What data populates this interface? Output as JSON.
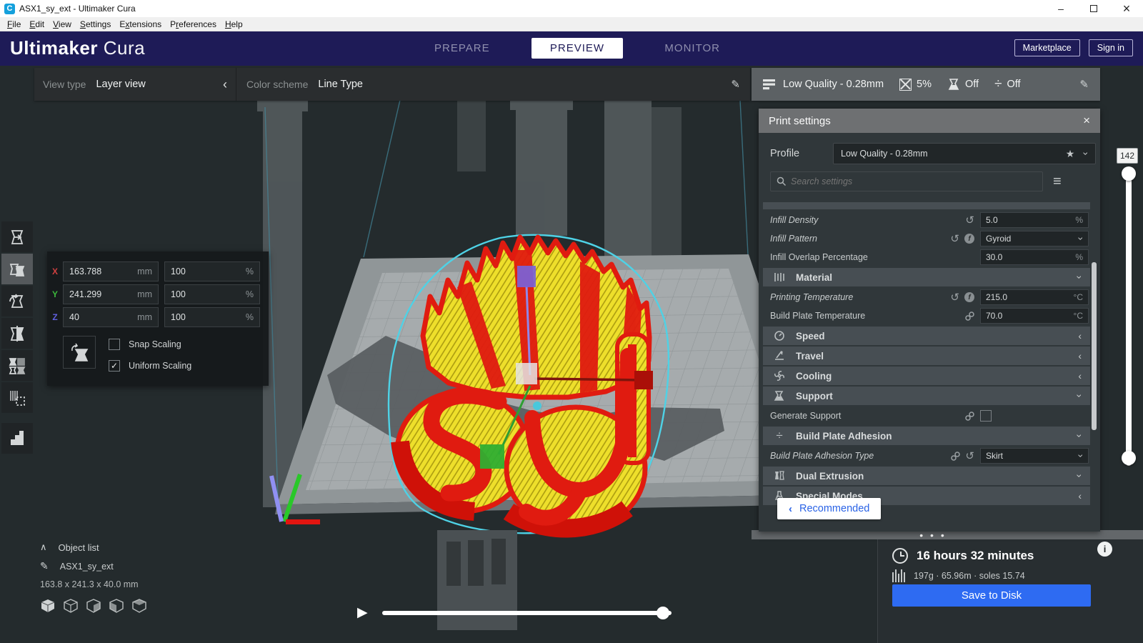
{
  "window": {
    "title": "ASX1_sy_ext - Ultimaker Cura",
    "icon_letter": "C",
    "menu": [
      "File",
      "Edit",
      "View",
      "Settings",
      "Extensions",
      "Preferences",
      "Help"
    ],
    "menu_accel": [
      0,
      0,
      0,
      0,
      1,
      1,
      0
    ]
  },
  "header": {
    "brand_bold": "Ultimaker",
    "brand_light": "Cura",
    "tabs": [
      "PREPARE",
      "PREVIEW",
      "MONITOR"
    ],
    "active_tab": "PREVIEW",
    "marketplace": "Marketplace",
    "sign_in": "Sign in",
    "accent": "#1e1b57"
  },
  "view_bar": {
    "view_type_label": "View type",
    "view_type_value": "Layer view",
    "color_scheme_label": "Color scheme",
    "color_scheme_value": "Line Type"
  },
  "summary": {
    "profile": "Low Quality - 0.28mm",
    "infill": "5%",
    "support": "Off",
    "adhesion": "Off"
  },
  "panel": {
    "title": "Print settings",
    "profile_label": "Profile",
    "profile_value": "Low Quality - 0.28mm",
    "search_placeholder": "Search settings",
    "recommended": "Recommended",
    "rows": [
      {
        "label": "Infill Density",
        "value": "5.0",
        "unit": "%"
      },
      {
        "label": "Infill Pattern",
        "value": "Gyroid"
      },
      {
        "label": "Infill Overlap Percentage",
        "value": "30.0",
        "unit": "%"
      },
      {
        "label": "Material"
      },
      {
        "label": "Printing Temperature",
        "value": "215.0",
        "unit": "°C"
      },
      {
        "label": "Build Plate Temperature",
        "value": "70.0",
        "unit": "°C"
      },
      {
        "label": "Speed"
      },
      {
        "label": "Travel"
      },
      {
        "label": "Cooling"
      },
      {
        "label": "Support"
      },
      {
        "label": "Generate Support"
      },
      {
        "label": "Build Plate Adhesion"
      },
      {
        "label": "Build Plate Adhesion Type",
        "value": "Skirt"
      },
      {
        "label": "Dual Extrusion"
      },
      {
        "label": "Special Modes"
      }
    ]
  },
  "scale": {
    "axes": [
      {
        "name": "X",
        "color": "#cf4040",
        "mm": "163.788",
        "pct": "100"
      },
      {
        "name": "Y",
        "color": "#3cb83c",
        "mm": "241.299",
        "pct": "100"
      },
      {
        "name": "Z",
        "color": "#6060e0",
        "mm": "40",
        "pct": "100"
      }
    ],
    "mm_unit": "mm",
    "pct_unit": "%",
    "snap_label": "Snap Scaling",
    "uniform_label": "Uniform Scaling",
    "uniform_check": "✓"
  },
  "objects": {
    "toggle_label": "Object list",
    "name": "ASX1_sy_ext",
    "dimensions": "163.8 x 241.3 x 40.0 mm"
  },
  "layers": {
    "current": "142"
  },
  "job": {
    "time": "16 hours 32 minutes",
    "material": "197g · 65.96m · soles 15.74",
    "save": "Save to Disk",
    "save_color": "#2e6bf2",
    "info_glyph": "i"
  },
  "glyphs": {
    "chevron_left": "‹",
    "chevron_right": "›",
    "pencil": "✎",
    "star": "★",
    "hamburger": "≡",
    "revert": "↺",
    "close": "×",
    "minimize": "–",
    "collapse_up": "∧",
    "play": "▶",
    "dots": "• • •",
    "divide": "÷",
    "fx": "f"
  }
}
